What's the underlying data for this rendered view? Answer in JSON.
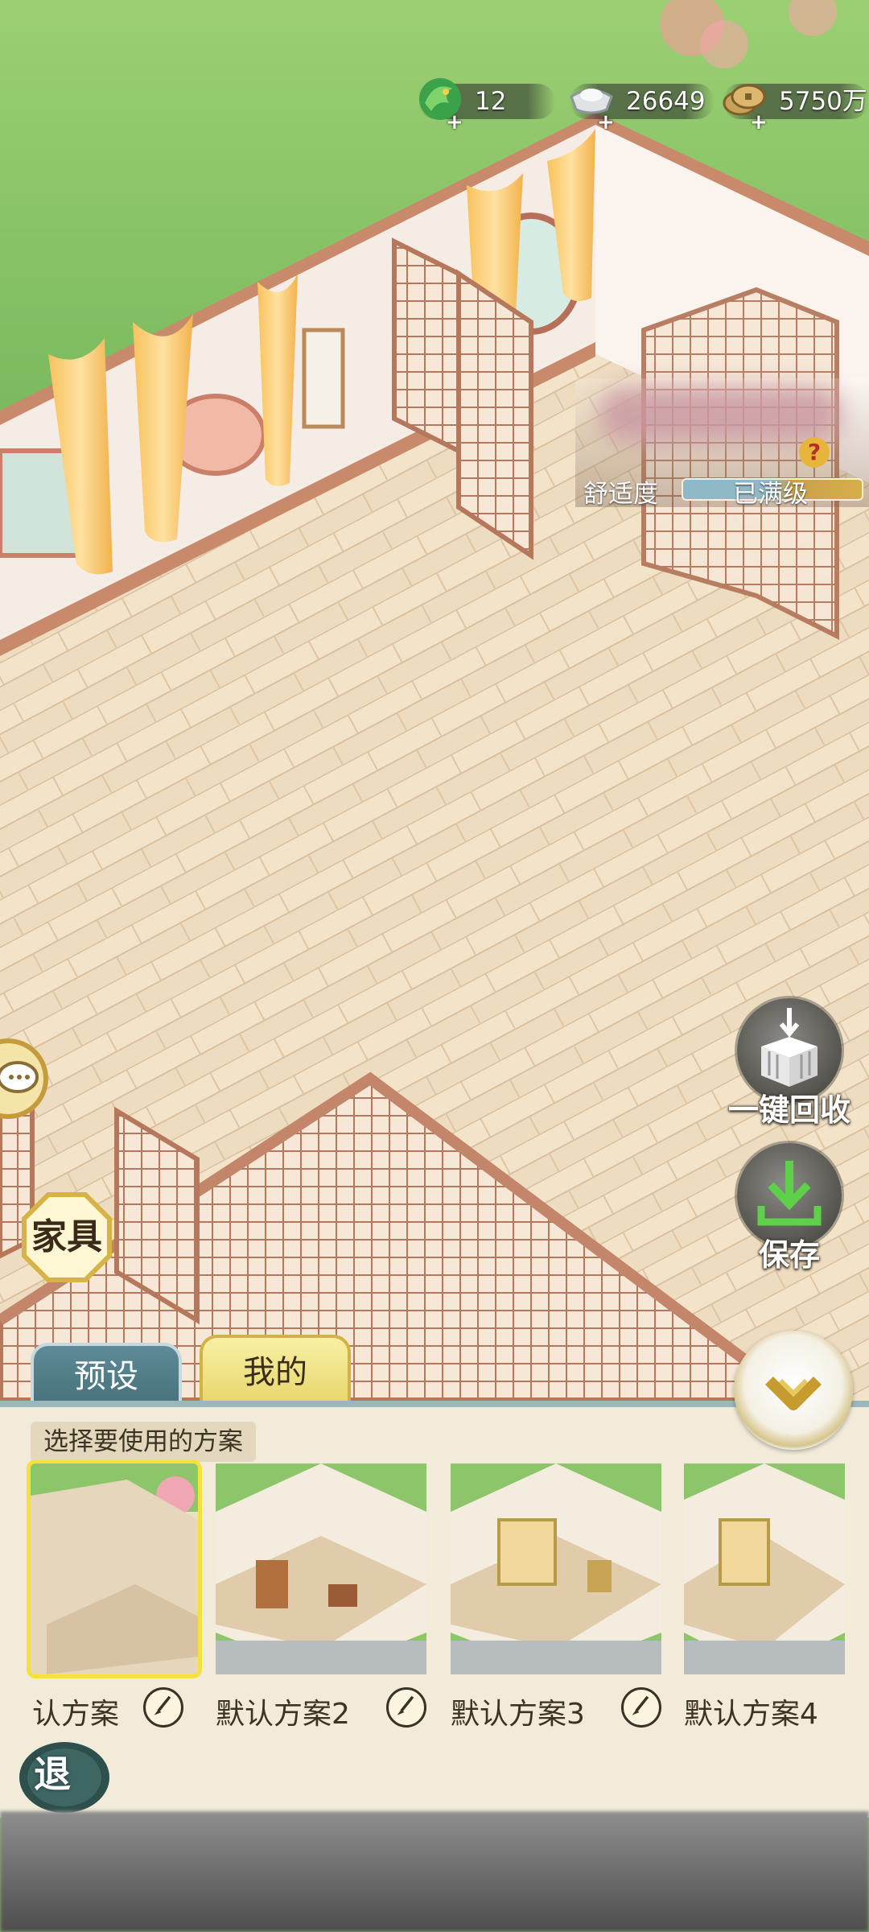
{
  "currencies": [
    {
      "icon": "jade-dragon-icon",
      "value": "12"
    },
    {
      "icon": "silver-ingot-icon",
      "value": "26649"
    },
    {
      "icon": "copper-coin-icon",
      "value": "5750万"
    }
  ],
  "comfort": {
    "label": "舒适度",
    "status": "已满级",
    "help": "?"
  },
  "actions": {
    "recycle_all": "一键回收",
    "save": "保存"
  },
  "furniture_label": "家具",
  "tabs": {
    "preset": "预设",
    "mine": "我的"
  },
  "panel": {
    "hint": "选择要使用的方案",
    "schemes": [
      {
        "name": "认方案",
        "selected": true
      },
      {
        "name": "默认方案2",
        "selected": false
      },
      {
        "name": "默认方案3",
        "selected": false
      },
      {
        "name": "默认方案4",
        "selected": false
      }
    ]
  },
  "exit_label": "退"
}
